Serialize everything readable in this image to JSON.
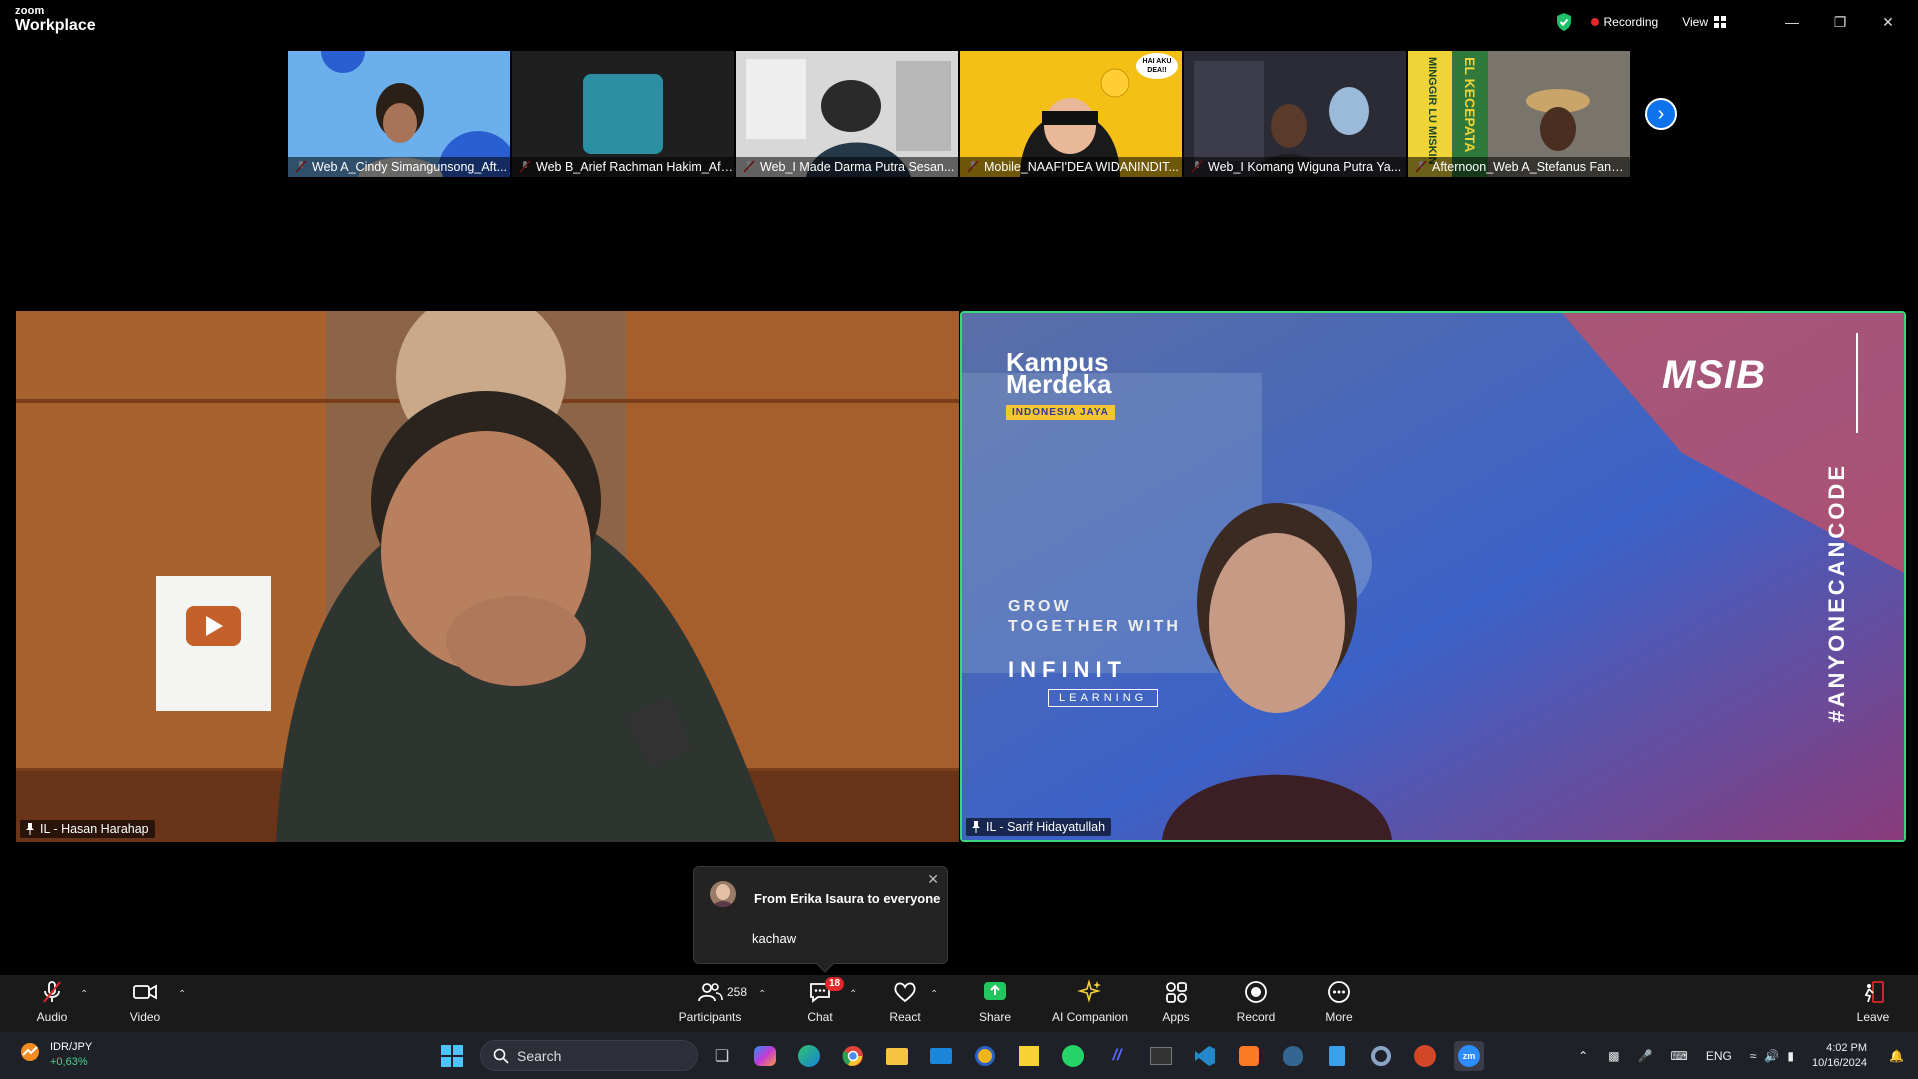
{
  "app": {
    "logo_top": "zoom",
    "logo_bottom": "Workplace",
    "recording_label": "Recording",
    "view_label": "View"
  },
  "thumbnails": [
    {
      "name": "Web A_Cindy Simangunsong_Aft..."
    },
    {
      "name": "Web B_Arief Rachman Hakim_Aft..."
    },
    {
      "name": "Web_I Made Darma Putra Sesan..."
    },
    {
      "name": "Mobile_NAAFI'DEA WIDANINDIT..."
    },
    {
      "name": "Web_I Komang Wiguna Putra Ya..."
    },
    {
      "name": "Afternoon_Web A_Stefanus Fandi..."
    }
  ],
  "thumb_overlays": {
    "bubble": "HAI AKU DEA!!",
    "poster_left": "MINGGIR LU MISKIN",
    "poster_right": "EL KECEPATA"
  },
  "main_videos": [
    {
      "name": "IL - Hasan Harahap"
    },
    {
      "name": "IL - Sarif Hidayatullah"
    }
  ],
  "background_text": {
    "kampus": "Kampus",
    "merdeka": "Merdeka",
    "indonesia": "INDONESIA JAYA",
    "grow": "GROW",
    "together": "TOGETHER WITH",
    "infinit": "INFINIT",
    "learning": "LEARNING",
    "msib": "MSIB",
    "hashtag": "#ANYONECANCODE"
  },
  "chat_toast": {
    "from": "From Erika Isaura to everyone",
    "message": "kachaw"
  },
  "toolbar": {
    "audio": "Audio",
    "video": "Video",
    "participants": "Participants",
    "participants_count": "258",
    "chat": "Chat",
    "chat_badge": "18",
    "react": "React",
    "share": "Share",
    "ai_companion": "AI Companion",
    "apps": "Apps",
    "record": "Record",
    "more": "More",
    "leave": "Leave"
  },
  "taskbar": {
    "ticker_name": "IDR/JPY",
    "ticker_change": "+0,63%",
    "search_label": "Search",
    "lang": "ENG",
    "time": "4:02 PM",
    "date": "10/16/2024"
  },
  "colors": {
    "accent_blue": "#0e72ed",
    "active_speaker": "#3dd57a",
    "recording_red": "#e0272c",
    "share_green": "#22c55e"
  }
}
